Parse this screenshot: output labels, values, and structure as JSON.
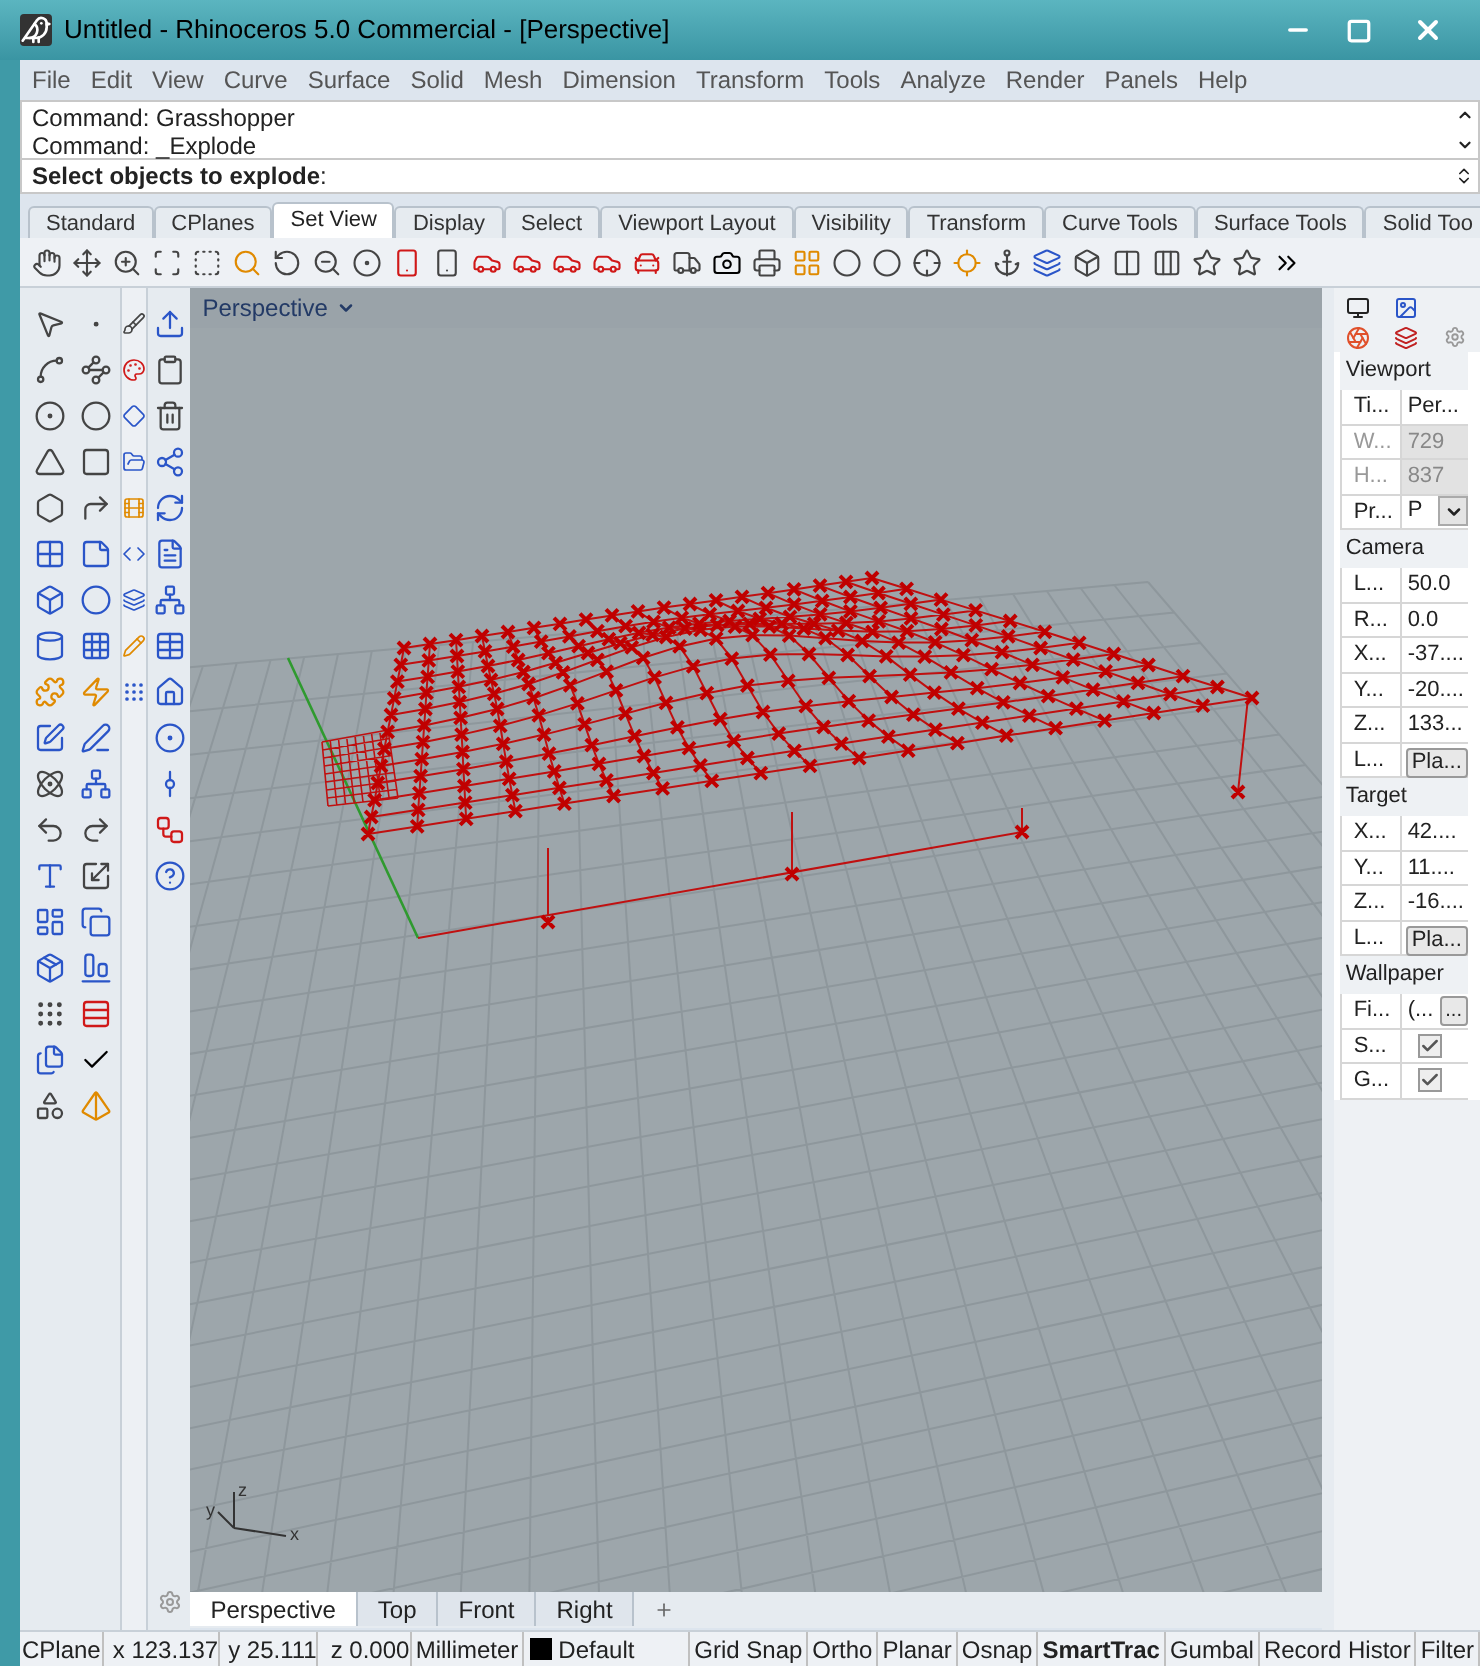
{
  "window": {
    "title": "Untitled - Rhinoceros 5.0 Commercial - [Perspective]"
  },
  "menu": [
    "File",
    "Edit",
    "View",
    "Curve",
    "Surface",
    "Solid",
    "Mesh",
    "Dimension",
    "Transform",
    "Tools",
    "Analyze",
    "Render",
    "Panels",
    "Help"
  ],
  "command_history": [
    "Command: Grasshopper",
    "Command: _Explode"
  ],
  "command_prompt": "**Select objects to explode**:",
  "toolbar_tabs": [
    {
      "label": "Standard",
      "selected": false
    },
    {
      "label": "CPlanes",
      "selected": false
    },
    {
      "label": "Set View",
      "selected": true
    },
    {
      "label": "Display",
      "selected": false
    },
    {
      "label": "Select",
      "selected": false
    },
    {
      "label": "Viewport Layout",
      "selected": false
    },
    {
      "label": "Visibility",
      "selected": false
    },
    {
      "label": "Transform",
      "selected": false
    },
    {
      "label": "Curve Tools",
      "selected": false
    },
    {
      "label": "Surface Tools",
      "selected": false
    },
    {
      "label": "Solid Too",
      "selected": false
    }
  ],
  "viewport": {
    "title": "Perspective",
    "axis_labels": [
      "y",
      "z",
      "x"
    ]
  },
  "viewport_tabs": [
    {
      "label": "Perspective",
      "selected": true
    },
    {
      "label": "Top",
      "selected": false
    },
    {
      "label": "Front",
      "selected": false
    },
    {
      "label": "Right",
      "selected": false
    }
  ],
  "properties": {
    "sections": [
      {
        "title": "Viewport",
        "rows": [
          {
            "kind": "text",
            "label": "Ti...",
            "value": "Per...",
            "disabled": false
          },
          {
            "kind": "text",
            "label": "W...",
            "value": "729",
            "disabled": true
          },
          {
            "kind": "text",
            "label": "H...",
            "value": "837",
            "disabled": true
          },
          {
            "kind": "dropdown",
            "label": "Pr...",
            "value": "P",
            "disabled": false
          }
        ]
      },
      {
        "title": "Camera",
        "rows": [
          {
            "kind": "text",
            "label": "L...",
            "value": "50.0",
            "disabled": false
          },
          {
            "kind": "text",
            "label": "R...",
            "value": "0.0",
            "disabled": false
          },
          {
            "kind": "text",
            "label": "X...",
            "value": "-37....",
            "disabled": false
          },
          {
            "kind": "text",
            "label": "Y...",
            "value": "-20....",
            "disabled": false
          },
          {
            "kind": "text",
            "label": "Z...",
            "value": "133...",
            "disabled": false
          },
          {
            "kind": "button",
            "label": "L...",
            "value": "Pla...",
            "disabled": false
          }
        ]
      },
      {
        "title": "Target",
        "rows": [
          {
            "kind": "text",
            "label": "X...",
            "value": "42....",
            "disabled": false
          },
          {
            "kind": "text",
            "label": "Y...",
            "value": "11....",
            "disabled": false
          },
          {
            "kind": "text",
            "label": "Z...",
            "value": "-16....",
            "disabled": false
          },
          {
            "kind": "button",
            "label": "L...",
            "value": "Pla...",
            "disabled": false
          }
        ]
      },
      {
        "title": "Wallpaper",
        "rows": [
          {
            "kind": "file",
            "label": "Fi...",
            "value": "(...",
            "button": "...",
            "disabled": false
          },
          {
            "kind": "checkbox",
            "label": "S...",
            "checked": true,
            "disabled": false
          },
          {
            "kind": "checkbox",
            "label": "G...",
            "checked": true,
            "disabled": false
          }
        ]
      }
    ]
  },
  "status_bar": {
    "cplane": "CPlane",
    "x": "x 123.137",
    "y": "y 25.111",
    "z": "z 0.000",
    "units": "Millimeter",
    "layer": {
      "name": "Default",
      "color": "#000000"
    },
    "toggles": [
      {
        "label": "Grid Snap",
        "on": false
      },
      {
        "label": "Ortho",
        "on": false
      },
      {
        "label": "Planar",
        "on": false
      },
      {
        "label": "Osnap",
        "on": false
      },
      {
        "label": "SmartTrac",
        "on": true
      },
      {
        "label": "Gumbal",
        "on": false
      },
      {
        "label": "Record Histor",
        "on": false
      },
      {
        "label": "Filter",
        "on": false
      }
    ]
  }
}
